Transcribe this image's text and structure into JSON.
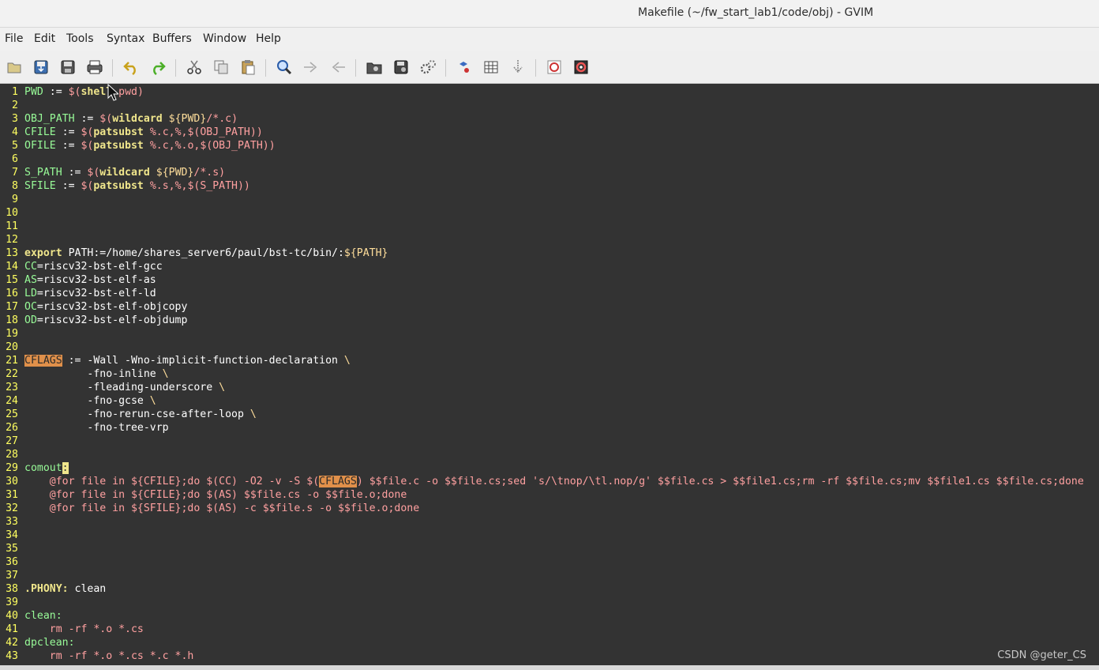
{
  "window": {
    "title": "Makefile (~/fw_start_lab1/code/obj) - GVIM"
  },
  "menu": [
    "File",
    "Edit",
    "Tools",
    "Syntax",
    "Buffers",
    "Window",
    "Help"
  ],
  "toolbar": [
    {
      "name": "open-icon"
    },
    {
      "name": "save-icon"
    },
    {
      "name": "save-all-icon"
    },
    {
      "name": "print-icon"
    },
    {
      "name": "undo-icon"
    },
    {
      "name": "redo-icon"
    },
    {
      "name": "cut-icon"
    },
    {
      "name": "copy-icon"
    },
    {
      "name": "paste-icon"
    },
    {
      "name": "find-replace-icon"
    },
    {
      "name": "find-next-icon"
    },
    {
      "name": "find-prev-icon"
    },
    {
      "name": "load-session-icon"
    },
    {
      "name": "save-session-icon"
    },
    {
      "name": "run-script-icon"
    },
    {
      "name": "make-icon"
    },
    {
      "name": "build-tags-icon"
    },
    {
      "name": "jump-tag-icon"
    },
    {
      "name": "help-icon"
    },
    {
      "name": "find-help-icon"
    }
  ],
  "editor": {
    "lines": [
      {
        "n": "1",
        "seg": [
          [
            "id",
            "PWD"
          ],
          [
            "st",
            " := "
          ],
          [
            "con",
            "$("
          ],
          [
            "kw",
            "shell"
          ],
          [
            "st",
            " "
          ],
          [
            "con",
            "pwd)"
          ]
        ]
      },
      {
        "n": "2",
        "seg": []
      },
      {
        "n": "3",
        "seg": [
          [
            "id",
            "OBJ_PATH"
          ],
          [
            "st",
            " := "
          ],
          [
            "con",
            "$("
          ],
          [
            "kw",
            "wildcard"
          ],
          [
            "st",
            " "
          ],
          [
            "var",
            "${PWD}"
          ],
          [
            "con",
            "/*.c)"
          ]
        ]
      },
      {
        "n": "4",
        "seg": [
          [
            "id",
            "CFILE"
          ],
          [
            "st",
            " := "
          ],
          [
            "con",
            "$("
          ],
          [
            "kw",
            "patsubst"
          ],
          [
            "st",
            " "
          ],
          [
            "con",
            "%.c,%,$(OBJ_PATH))"
          ]
        ]
      },
      {
        "n": "5",
        "seg": [
          [
            "id",
            "OFILE"
          ],
          [
            "st",
            " := "
          ],
          [
            "con",
            "$("
          ],
          [
            "kw",
            "patsubst"
          ],
          [
            "st",
            " "
          ],
          [
            "con",
            "%.c,%.o,$(OBJ_PATH))"
          ]
        ]
      },
      {
        "n": "6",
        "seg": []
      },
      {
        "n": "7",
        "seg": [
          [
            "id",
            "S_PATH"
          ],
          [
            "st",
            " := "
          ],
          [
            "con",
            "$("
          ],
          [
            "kw",
            "wildcard"
          ],
          [
            "st",
            " "
          ],
          [
            "var",
            "${PWD}"
          ],
          [
            "con",
            "/*.s)"
          ]
        ]
      },
      {
        "n": "8",
        "seg": [
          [
            "id",
            "SFILE"
          ],
          [
            "st",
            " := "
          ],
          [
            "con",
            "$("
          ],
          [
            "kw",
            "patsubst"
          ],
          [
            "st",
            " "
          ],
          [
            "con",
            "%.s,%,$(S_PATH))"
          ]
        ]
      },
      {
        "n": "9",
        "seg": []
      },
      {
        "n": "10",
        "seg": []
      },
      {
        "n": "11",
        "seg": []
      },
      {
        "n": "12",
        "seg": []
      },
      {
        "n": "13",
        "seg": [
          [
            "kw",
            "export"
          ],
          [
            "st",
            " PATH:=/home/shares_server6/paul/bst-tc/bin/:"
          ],
          [
            "var",
            "${PATH}"
          ]
        ]
      },
      {
        "n": "14",
        "seg": [
          [
            "id",
            "CC"
          ],
          [
            "st",
            "=riscv32-bst-elf-gcc"
          ]
        ]
      },
      {
        "n": "15",
        "seg": [
          [
            "id",
            "AS"
          ],
          [
            "st",
            "=riscv32-bst-elf-as"
          ]
        ]
      },
      {
        "n": "16",
        "seg": [
          [
            "id",
            "LD"
          ],
          [
            "st",
            "=riscv32-bst-elf-ld"
          ]
        ]
      },
      {
        "n": "17",
        "seg": [
          [
            "id",
            "OC"
          ],
          [
            "st",
            "=riscv32-bst-elf-objcopy"
          ]
        ]
      },
      {
        "n": "18",
        "seg": [
          [
            "id",
            "OD"
          ],
          [
            "st",
            "=riscv32-bst-elf-objdump"
          ]
        ]
      },
      {
        "n": "19",
        "seg": []
      },
      {
        "n": "20",
        "seg": []
      },
      {
        "n": "21",
        "seg": [
          [
            "hl",
            "CFLAGS"
          ],
          [
            "st",
            " := -Wall -Wno-implicit-function-declaration "
          ],
          [
            "var",
            "\\"
          ]
        ]
      },
      {
        "n": "22",
        "seg": [
          [
            "st",
            "          -fno-inline "
          ],
          [
            "var",
            "\\"
          ]
        ]
      },
      {
        "n": "23",
        "seg": [
          [
            "st",
            "          -fleading-underscore "
          ],
          [
            "var",
            "\\"
          ]
        ]
      },
      {
        "n": "24",
        "seg": [
          [
            "st",
            "          -fno-gcse "
          ],
          [
            "var",
            "\\"
          ]
        ]
      },
      {
        "n": "25",
        "seg": [
          [
            "st",
            "          -fno-rerun-cse-after-loop "
          ],
          [
            "var",
            "\\"
          ]
        ]
      },
      {
        "n": "26",
        "seg": [
          [
            "st",
            "          -fno-tree-vrp"
          ]
        ]
      },
      {
        "n": "27",
        "seg": []
      },
      {
        "n": "28",
        "seg": []
      },
      {
        "n": "29",
        "seg": [
          [
            "id",
            "comout"
          ],
          [
            "cur",
            ":"
          ]
        ]
      },
      {
        "n": "30",
        "seg": [
          [
            "con",
            "    @for file in ${CFILE};do $(CC) -O2 -v -S $("
          ],
          [
            "hl",
            "CFLAGS"
          ],
          [
            "con",
            ") $$file.c -o $$file.cs;sed 's/\\tnop/\\tl.nop/g' $$file.cs > $$file1.cs;rm -rf $$file.cs;mv $$file1.cs $$file.cs;done"
          ]
        ]
      },
      {
        "n": "31",
        "seg": [
          [
            "con",
            "    @for file in ${CFILE};do $(AS) $$file.cs -o $$file.o;done"
          ]
        ]
      },
      {
        "n": "32",
        "seg": [
          [
            "con",
            "    @for file in ${SFILE};do $(AS) -c $$file.s -o $$file.o;done"
          ]
        ]
      },
      {
        "n": "33",
        "seg": []
      },
      {
        "n": "34",
        "seg": []
      },
      {
        "n": "35",
        "seg": []
      },
      {
        "n": "36",
        "seg": []
      },
      {
        "n": "37",
        "seg": []
      },
      {
        "n": "38",
        "seg": [
          [
            "kw",
            ".PHONY:"
          ],
          [
            "st",
            " clean"
          ]
        ]
      },
      {
        "n": "39",
        "seg": []
      },
      {
        "n": "40",
        "seg": [
          [
            "id",
            "clean:"
          ]
        ]
      },
      {
        "n": "41",
        "seg": [
          [
            "con",
            "    rm -rf *.o *.cs"
          ]
        ]
      },
      {
        "n": "42",
        "seg": [
          [
            "id",
            "dpclean:"
          ]
        ]
      },
      {
        "n": "43",
        "seg": [
          [
            "con",
            "    rm -rf *.o *.cs *.c *.h"
          ]
        ]
      }
    ]
  },
  "watermark": "CSDN @geter_CS"
}
